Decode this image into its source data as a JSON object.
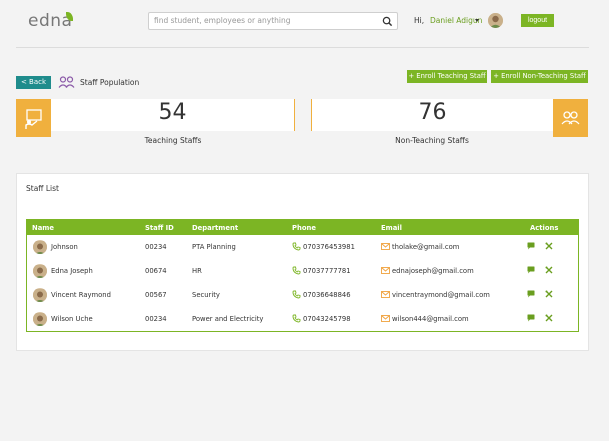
{
  "app": {
    "logo_text": "edna",
    "colors": {
      "brand_green": "#7cb524",
      "teal": "#1f8c8c",
      "accent_orange": "#f0b03e"
    }
  },
  "header": {
    "search_placeholder": "find student, employees or anything",
    "greeting": "Hi,",
    "user_name": "Daniel Adigun",
    "logout_label": "logout"
  },
  "page": {
    "back_label": "< Back",
    "title": "Staff Population",
    "enroll_teaching_label": "+ Enroll Teaching Staff",
    "enroll_nonteaching_label": "+ Enroll Non-Teaching Staff"
  },
  "stats": {
    "teaching": {
      "value": "54",
      "label": "Teaching Staffs"
    },
    "nonteaching": {
      "value": "76",
      "label": "Non-Teaching Staffs"
    }
  },
  "staff_list": {
    "title": "Staff List",
    "columns": [
      "Name",
      "Staff ID",
      "Department",
      "Phone",
      "Email",
      "Actions"
    ],
    "rows": [
      {
        "name": "Johnson",
        "staff_id": "00234",
        "department": "PTA Planning",
        "phone": "070376453981",
        "email": "tholake@gmail.com"
      },
      {
        "name": "Edna Joseph",
        "staff_id": "00674",
        "department": "HR",
        "phone": "07037777781",
        "email": "ednajoseph@gmail.com"
      },
      {
        "name": "Vincent Raymond",
        "staff_id": "00567",
        "department": "Security",
        "phone": "07036648846",
        "email": "vincentraymond@gmail.com"
      },
      {
        "name": "Wilson Uche",
        "staff_id": "00234",
        "department": "Power and Electricity",
        "phone": "07043245798",
        "email": "wilson444@gmail.com"
      }
    ]
  }
}
